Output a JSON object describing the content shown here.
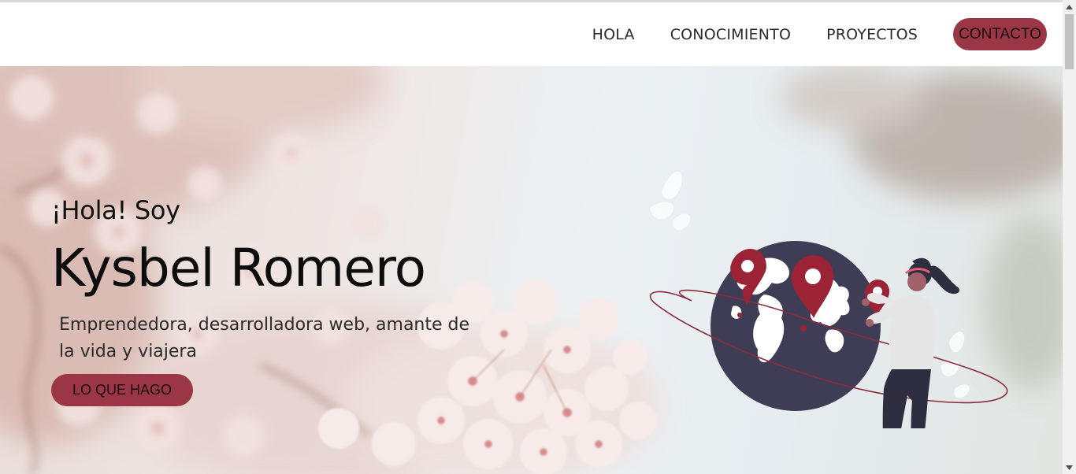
{
  "nav": {
    "items": [
      {
        "label": "HOLA"
      },
      {
        "label": "CONOCIMIENTO"
      },
      {
        "label": "PROYECTOS"
      }
    ],
    "contact_label": "CONTACTO"
  },
  "hero": {
    "greeting": "¡Hola! Soy",
    "name": "Kysbel Romero",
    "tagline": "Emprendedora, desarrolladora web, amante de la vida y viajera",
    "cta_label": "LO QUE HAGO",
    "illustration": "woman-with-globe-and-map-pins-illustration",
    "background": "cherry-blossom-photo"
  },
  "colors": {
    "accent": "#9b3646",
    "globe": "#3f3d56",
    "text": "#1b1b1b"
  }
}
